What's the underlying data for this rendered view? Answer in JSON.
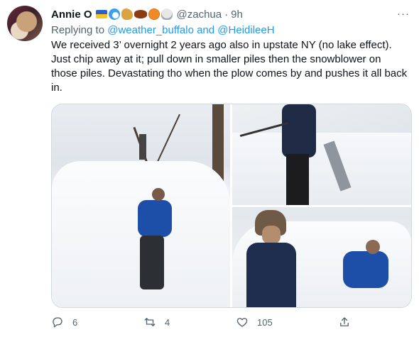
{
  "tweet": {
    "display_name": "Annie O",
    "emojis": [
      "flag-icon",
      "wave-icon",
      "horse-icon",
      "football-icon",
      "basketball-icon",
      "skull-icon"
    ],
    "handle": "@zachua",
    "separator": "·",
    "time": "9h",
    "more_label": "···",
    "replying_prefix": "Replying to ",
    "replying_to": "@weather_buffalo and @HeidileeH",
    "text": "We received 3’ overnight 2 years ago also in upstate NY (no lake effect). Just chip away at it; pull down in smaller piles then the snowblower on those piles. Devastating tho when the plow comes by and pushes it all back in."
  },
  "media": {
    "photos": [
      "photo-man-lying-on-snow-bank",
      "photo-snowblower-in-deep-snow",
      "photo-two-men-by-snow-bank"
    ]
  },
  "actions": {
    "reply_count": "6",
    "retweet_count": "4",
    "like_count": "105"
  },
  "colors": {
    "accent": "#1d9bf0",
    "secondary_text": "#536471",
    "border": "#cfd9de"
  }
}
